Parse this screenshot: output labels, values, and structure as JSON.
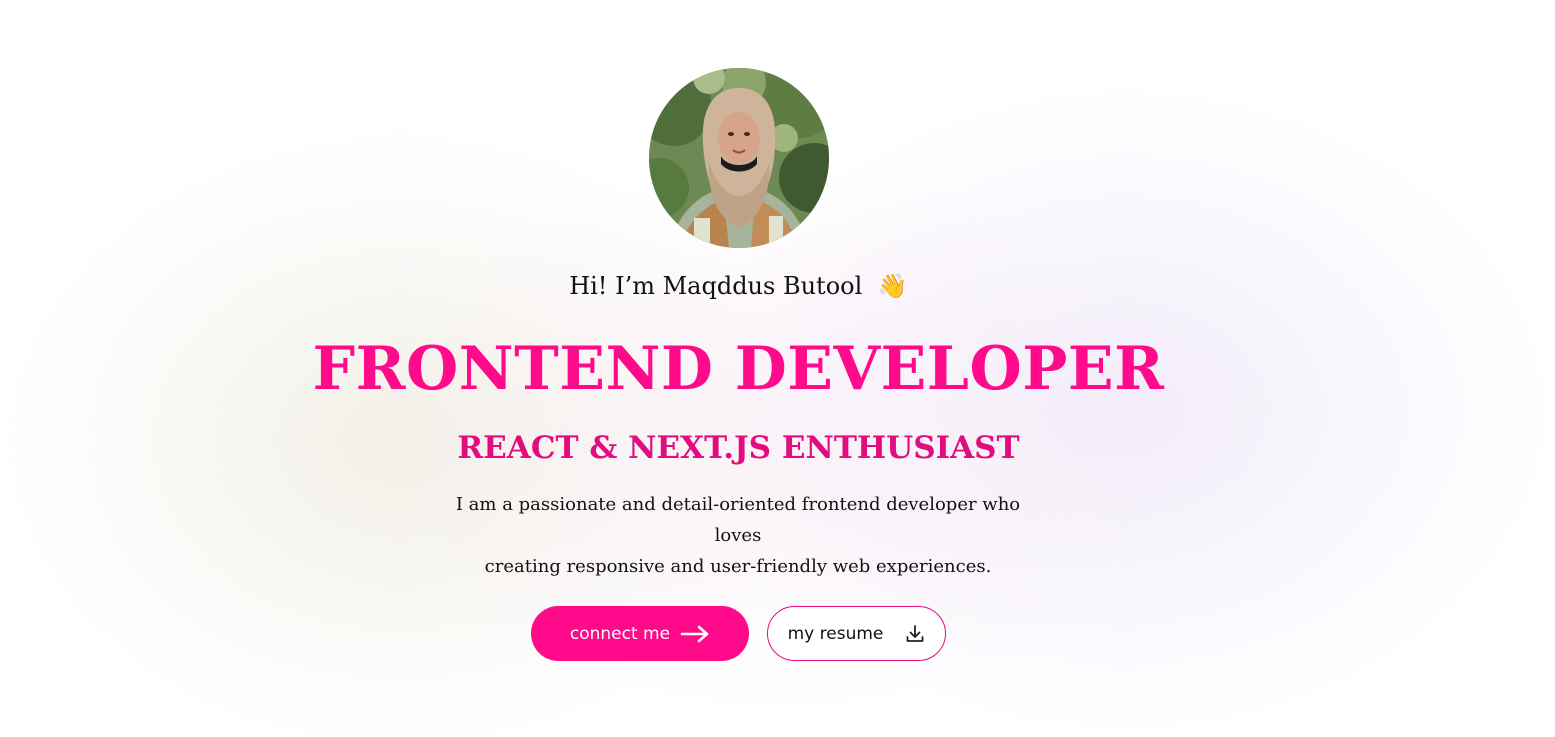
{
  "hero": {
    "greeting": "Hi! I’m Maqddus Butool",
    "wave_emoji": "👋",
    "title": "FRONTEND DEVELOPER",
    "subtitle": "REACT & NEXT.JS ENTHUSIAST",
    "intro_line1": "I am a passionate and detail-oriented frontend developer who loves",
    "intro_line2": "creating responsive and user-friendly web experiences."
  },
  "buttons": {
    "connect_label": "connect me",
    "connect_icon": "arrow-right-icon",
    "resume_label": "my resume",
    "resume_icon": "download-icon"
  },
  "colors": {
    "accent": "#ff0a8a",
    "subtitle": "#e20c80",
    "text": "#111111",
    "background": "#ffffff"
  }
}
